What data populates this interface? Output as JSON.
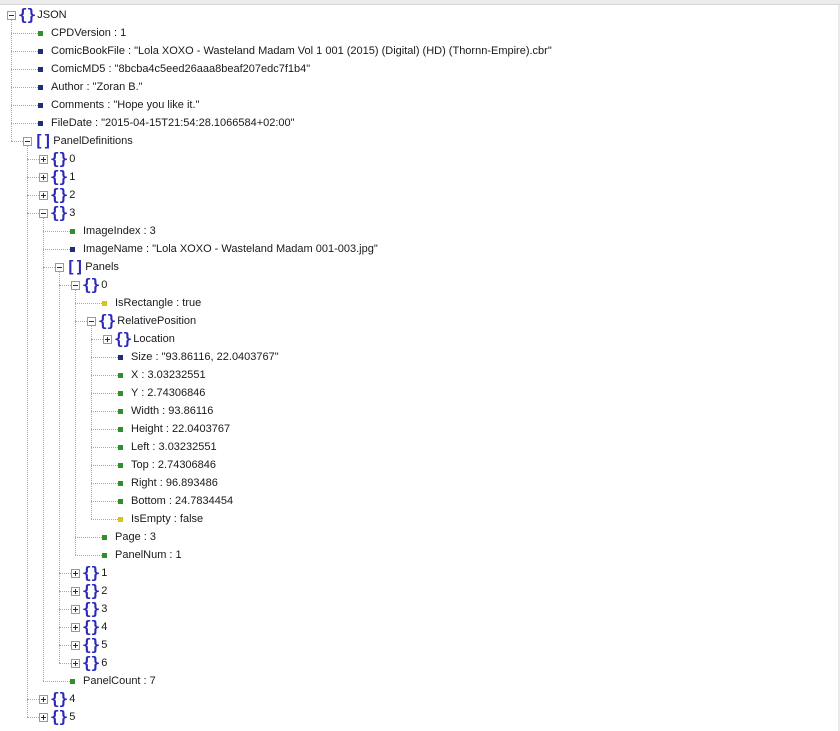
{
  "colors": {
    "number_leaf": "#2f8f2f",
    "string_leaf": "#1e2f7a",
    "boolean_leaf": "#d6c21a",
    "brace": "#2a2ab8"
  },
  "tree": {
    "nodes": [
      {
        "depth": 0,
        "kind": "object",
        "expanded": true,
        "text": "JSON"
      },
      {
        "depth": 1,
        "kind": "number",
        "text": "CPDVersion : 1"
      },
      {
        "depth": 1,
        "kind": "string",
        "text": "ComicBookFile : \"Lola XOXO - Wasteland Madam Vol 1 001 (2015) (Digital) (HD) (Thornn-Empire).cbr\""
      },
      {
        "depth": 1,
        "kind": "string",
        "text": "ComicMD5 : \"8bcba4c5eed26aaa8beaf207edc7f1b4\""
      },
      {
        "depth": 1,
        "kind": "string",
        "text": "Author : \"Zoran B.\""
      },
      {
        "depth": 1,
        "kind": "string",
        "text": "Comments : \"Hope you like it.\""
      },
      {
        "depth": 1,
        "kind": "string",
        "text": "FileDate : \"2015-04-15T21:54:28.1066584+02:00\""
      },
      {
        "depth": 1,
        "kind": "array",
        "expanded": true,
        "text": "PanelDefinitions"
      },
      {
        "depth": 2,
        "kind": "object",
        "expanded": false,
        "text": "0"
      },
      {
        "depth": 2,
        "kind": "object",
        "expanded": false,
        "text": "1"
      },
      {
        "depth": 2,
        "kind": "object",
        "expanded": false,
        "text": "2"
      },
      {
        "depth": 2,
        "kind": "object",
        "expanded": true,
        "text": "3"
      },
      {
        "depth": 3,
        "kind": "number",
        "text": "ImageIndex : 3"
      },
      {
        "depth": 3,
        "kind": "string",
        "text": "ImageName : \"Lola XOXO - Wasteland Madam 001-003.jpg\""
      },
      {
        "depth": 3,
        "kind": "array",
        "expanded": true,
        "text": "Panels"
      },
      {
        "depth": 4,
        "kind": "object",
        "expanded": true,
        "text": "0"
      },
      {
        "depth": 5,
        "kind": "boolean",
        "text": "IsRectangle : true"
      },
      {
        "depth": 5,
        "kind": "object",
        "expanded": true,
        "text": "RelativePosition"
      },
      {
        "depth": 6,
        "kind": "object",
        "expanded": false,
        "text": "Location"
      },
      {
        "depth": 6,
        "kind": "string",
        "text": "Size : \"93.86116, 22.0403767\""
      },
      {
        "depth": 6,
        "kind": "number",
        "text": "X : 3.03232551"
      },
      {
        "depth": 6,
        "kind": "number",
        "text": "Y : 2.74306846"
      },
      {
        "depth": 6,
        "kind": "number",
        "text": "Width : 93.86116"
      },
      {
        "depth": 6,
        "kind": "number",
        "text": "Height : 22.0403767"
      },
      {
        "depth": 6,
        "kind": "number",
        "text": "Left : 3.03232551"
      },
      {
        "depth": 6,
        "kind": "number",
        "text": "Top : 2.74306846"
      },
      {
        "depth": 6,
        "kind": "number",
        "text": "Right : 96.893486"
      },
      {
        "depth": 6,
        "kind": "number",
        "text": "Bottom : 24.7834454"
      },
      {
        "depth": 6,
        "kind": "boolean",
        "text": "IsEmpty : false"
      },
      {
        "depth": 5,
        "kind": "number",
        "text": "Page : 3"
      },
      {
        "depth": 5,
        "kind": "number",
        "text": "PanelNum : 1"
      },
      {
        "depth": 4,
        "kind": "object",
        "expanded": false,
        "text": "1"
      },
      {
        "depth": 4,
        "kind": "object",
        "expanded": false,
        "text": "2"
      },
      {
        "depth": 4,
        "kind": "object",
        "expanded": false,
        "text": "3"
      },
      {
        "depth": 4,
        "kind": "object",
        "expanded": false,
        "text": "4"
      },
      {
        "depth": 4,
        "kind": "object",
        "expanded": false,
        "text": "5"
      },
      {
        "depth": 4,
        "kind": "object",
        "expanded": false,
        "text": "6"
      },
      {
        "depth": 3,
        "kind": "number",
        "text": "PanelCount : 7"
      },
      {
        "depth": 2,
        "kind": "object",
        "expanded": false,
        "text": "4"
      },
      {
        "depth": 2,
        "kind": "object",
        "expanded": false,
        "text": "5"
      }
    ]
  }
}
